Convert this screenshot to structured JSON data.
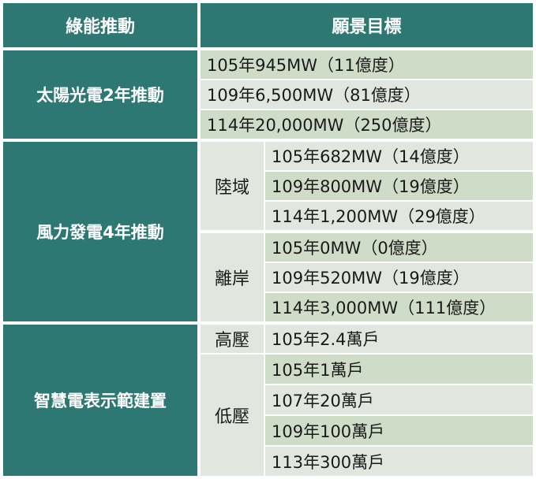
{
  "headers": {
    "col1": "綠能推動",
    "col2": "願景目標"
  },
  "solar": {
    "label": "太陽光電2年推動",
    "rows": [
      "105年945MW（11億度）",
      "109年6,500MW（81億度）",
      "114年20,000MW（250億度）"
    ]
  },
  "wind": {
    "label": "風力發電4年推動",
    "onshore": {
      "label": "陸域",
      "rows": [
        "105年682MW（14億度）",
        "109年800MW（19億度）",
        "114年1,200MW（29億度）"
      ]
    },
    "offshore": {
      "label": "離岸",
      "rows": [
        "105年0MW（0億度）",
        "109年520MW（19億度）",
        "114年3,000MW（111億度）"
      ]
    }
  },
  "meter": {
    "label": "智慧電表示範建置",
    "high": {
      "label": "高壓",
      "rows": [
        "105年2.4萬戶"
      ]
    },
    "low": {
      "label": "低壓",
      "rows": [
        "105年1萬戶",
        "107年20萬戶",
        "109年100萬戶",
        "113年300萬戶"
      ]
    }
  },
  "colors": {
    "teal": "#2e7873",
    "row_light": "#e1e6df",
    "row_dark": "#cfdcc8"
  }
}
